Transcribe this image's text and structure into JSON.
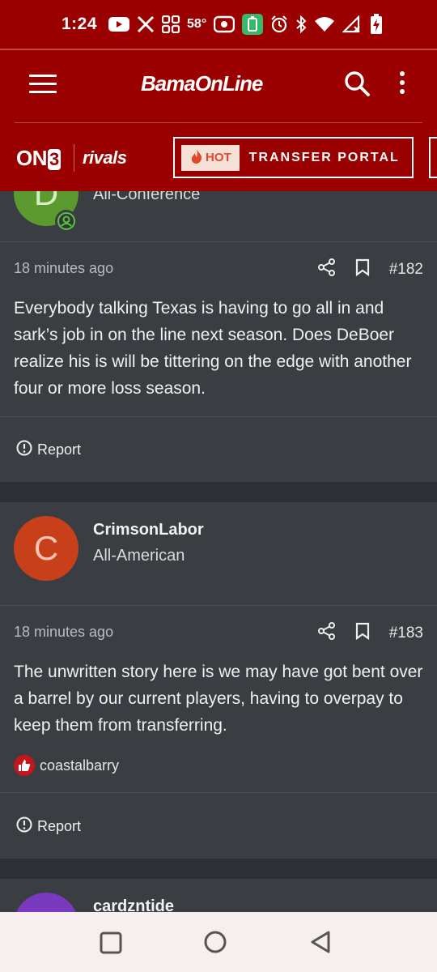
{
  "status_bar": {
    "time": "1:24",
    "temperature": "58°",
    "icons": [
      "youtube-icon",
      "x-icon",
      "grid-app-icon",
      "temperature",
      "radio-icon",
      "battery-saver-icon",
      "alarm-icon",
      "bluetooth-icon",
      "wifi-icon",
      "signal-icon",
      "battery-charging-icon"
    ]
  },
  "header": {
    "brand": "BamaOnLine",
    "network_logo": "ON3",
    "network_logo_prefix": "ON",
    "network_logo_digit": "3",
    "partner_logo": "rivals",
    "hot_label": "HOT",
    "portal_label": "TRANSFER PORTAL"
  },
  "posts": [
    {
      "author_rank": "All-Conference",
      "avatar_letter": "D",
      "avatar_color": "#5a9a2e",
      "time": "18 minutes ago",
      "number": "#182",
      "body": "Everybody talking Texas is having to go all in and sark’s job in on the line next season. Does DeBoer realize his is will be tittering on the edge with another four or more loss season.",
      "report_label": "Report"
    },
    {
      "author_name": "CrimsonLabor",
      "author_rank": "All-American",
      "avatar_letter": "C",
      "avatar_color": "#c8401a",
      "time": "18 minutes ago",
      "number": "#183",
      "body": "The unwritten story here is we may have got bent over a barrel by our current players, having to overpay to keep them from transferring.",
      "liked_by": "coastalbarry",
      "report_label": "Report"
    },
    {
      "author_name": "cardzntide",
      "avatar_color": "#7a3ac0"
    }
  ],
  "colors": {
    "brand_red": "#9a0000",
    "card_bg": "#3a3d42",
    "page_bg": "#2a2d31"
  }
}
